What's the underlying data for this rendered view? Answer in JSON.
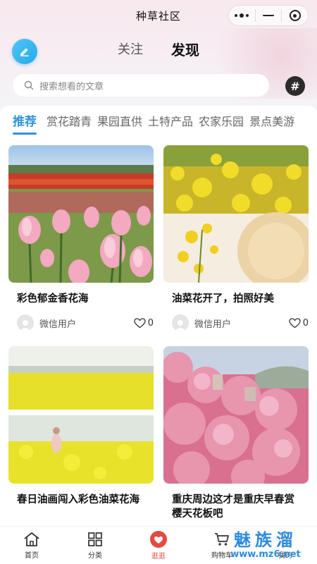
{
  "app": {
    "title": "种草社区"
  },
  "header": {
    "tabs": [
      {
        "label": "关注",
        "active": false
      },
      {
        "label": "发现",
        "active": true
      }
    ]
  },
  "search": {
    "placeholder": "搜索想看的文章",
    "hash_label": "#"
  },
  "categories": [
    {
      "label": "推荐",
      "active": true
    },
    {
      "label": "赏花踏青",
      "active": false
    },
    {
      "label": "果园直供",
      "active": false
    },
    {
      "label": "土特产品",
      "active": false
    },
    {
      "label": "农家乐园",
      "active": false
    },
    {
      "label": "景点美游",
      "active": false
    }
  ],
  "posts": [
    {
      "title": "彩色郁金香花海",
      "user": "微信用户",
      "likes": "0",
      "image": "tulip-field"
    },
    {
      "title": "油菜花开了，拍照好美",
      "user": "微信用户",
      "likes": "0",
      "image": "rapeseed-closeup"
    },
    {
      "title": "春日油画闯入彩色油菜花海",
      "user": "",
      "likes": "",
      "image": "rapeseed-field"
    },
    {
      "title": "重庆周边这才是重庆早春赏樱天花板吧",
      "user": "",
      "likes": "",
      "image": "cherry-blossom-hill"
    }
  ],
  "tabbar": [
    {
      "label": "首页",
      "icon": "home-icon",
      "active": false
    },
    {
      "label": "分类",
      "icon": "grid-icon",
      "active": false
    },
    {
      "label": "逛逛",
      "icon": "heart-icon",
      "active": true
    },
    {
      "label": "购物车",
      "icon": "cart-icon",
      "active": false
    },
    {
      "label": "我的",
      "icon": "user-icon",
      "active": false
    }
  ],
  "watermark": {
    "text": "魅族溜",
    "url": "www.mz6.net"
  },
  "colors": {
    "accent": "#2f94d8",
    "edit_button": "#27a8eb",
    "tab_active": "#e24b3f"
  }
}
